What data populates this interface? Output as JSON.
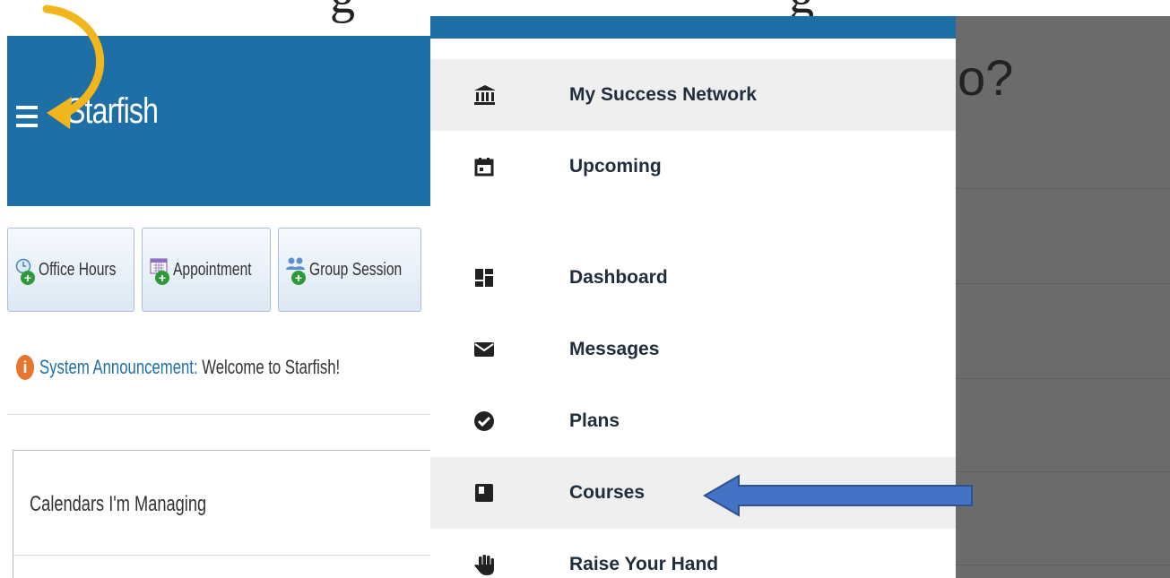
{
  "app": {
    "brand": "Starfish"
  },
  "toolbar": {
    "office_hours": "Office Hours",
    "appointment": "Appointment",
    "group_session": "Group Session"
  },
  "announcement": {
    "label": "System Announcement:",
    "message": " Welcome to Starfish!"
  },
  "calendars": {
    "title": "Calendars I'm Managing"
  },
  "menu": {
    "items": [
      {
        "label": "My Success Network",
        "icon": "bank-icon"
      },
      {
        "label": "Upcoming",
        "icon": "calendar-icon"
      },
      {
        "label": "Dashboard",
        "icon": "dashboard-icon"
      },
      {
        "label": "Messages",
        "icon": "envelope-icon"
      },
      {
        "label": "Plans",
        "icon": "check-circle-icon"
      },
      {
        "label": "Courses",
        "icon": "book-icon"
      },
      {
        "label": "Raise Your Hand",
        "icon": "hand-icon"
      }
    ]
  },
  "background": {
    "partial_heading": "o?"
  },
  "colors": {
    "brand_blue": "#1e6fa6",
    "arrow_gold": "#f2b61c",
    "arrow_blue": "#4472c4"
  }
}
